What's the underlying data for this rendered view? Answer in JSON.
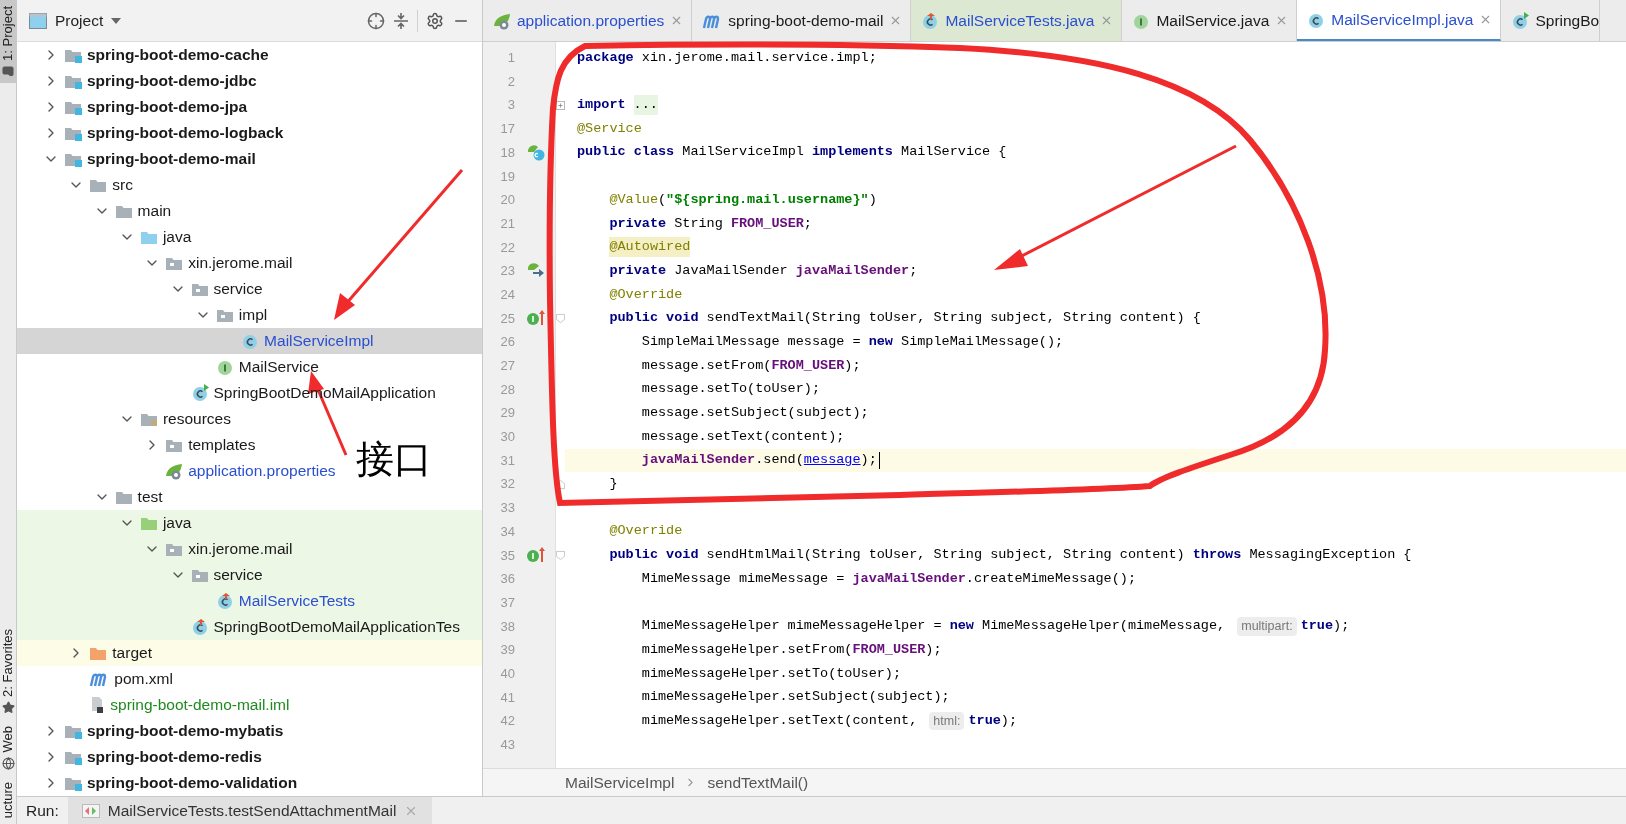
{
  "tool_strip": [
    {
      "label": "1: Project",
      "selected": true
    },
    {
      "label": "2: Favorites",
      "selected": false
    },
    {
      "label": "Web",
      "selected": false
    },
    {
      "label": "ucture",
      "selected": false
    }
  ],
  "project_panel": {
    "title": "Project",
    "tree": [
      {
        "label": "spring-boot-demo-cache",
        "kind": "module",
        "expanded": false,
        "selected": false
      },
      {
        "label": "spring-boot-demo-jdbc",
        "kind": "module",
        "expanded": false,
        "selected": false
      },
      {
        "label": "spring-boot-demo-jpa",
        "kind": "module",
        "expanded": false,
        "selected": false
      },
      {
        "label": "spring-boot-demo-logback",
        "kind": "module",
        "expanded": false,
        "selected": false
      },
      {
        "label": "spring-boot-demo-mail",
        "kind": "module",
        "expanded": true,
        "selected": false,
        "children": [
          {
            "label": "src",
            "kind": "folder",
            "expanded": true,
            "selected": false,
            "children": [
              {
                "label": "main",
                "kind": "folder",
                "expanded": true,
                "selected": false,
                "children": [
                  {
                    "label": "java",
                    "kind": "source-folder",
                    "expanded": true,
                    "selected": false,
                    "children": [
                      {
                        "label": "xin.jerome.mail",
                        "kind": "package",
                        "expanded": true,
                        "selected": false,
                        "children": [
                          {
                            "label": "service",
                            "kind": "package",
                            "expanded": true,
                            "selected": false,
                            "children": [
                              {
                                "label": "impl",
                                "kind": "package",
                                "expanded": true,
                                "selected": false,
                                "children": [
                                  {
                                    "label": "MailServiceImpl",
                                    "kind": "class",
                                    "color": "#2a4fcf",
                                    "selected": true
                                  }
                                ]
                              },
                              {
                                "label": "MailService",
                                "kind": "interface",
                                "selected": false
                              }
                            ]
                          },
                          {
                            "label": "SpringBootDemoMailApplication",
                            "kind": "boot-class",
                            "selected": false
                          }
                        ]
                      }
                    ]
                  },
                  {
                    "label": "resources",
                    "kind": "resources-folder",
                    "expanded": true,
                    "selected": false,
                    "children": [
                      {
                        "label": "templates",
                        "kind": "package",
                        "expanded": false,
                        "selected": false
                      },
                      {
                        "label": "application.properties",
                        "kind": "properties",
                        "color": "#2a4fcf",
                        "selected": false
                      }
                    ]
                  }
                ]
              },
              {
                "label": "test",
                "kind": "folder",
                "expanded": true,
                "selected": false,
                "children": [
                  {
                    "label": "java",
                    "kind": "test-folder",
                    "expanded": true,
                    "selected": false,
                    "children": [
                      {
                        "label": "xin.jerome.mail",
                        "kind": "package",
                        "expanded": true,
                        "selected": false,
                        "children": [
                          {
                            "label": "service",
                            "kind": "package",
                            "expanded": true,
                            "selected": false,
                            "children": [
                              {
                                "label": "MailServiceTests",
                                "kind": "test-class",
                                "color": "#2a4fcf",
                                "selected": false
                              }
                            ]
                          },
                          {
                            "label": "SpringBootDemoMailApplicationTes",
                            "kind": "test-class",
                            "selected": false
                          }
                        ]
                      }
                    ]
                  }
                ]
              }
            ]
          },
          {
            "label": "target",
            "kind": "excluded-folder",
            "expanded": false,
            "selected": false
          },
          {
            "label": "pom.xml",
            "kind": "maven",
            "selected": false
          },
          {
            "label": "spring-boot-demo-mail.iml",
            "kind": "iml",
            "color": "#1f8a1f",
            "selected": false
          }
        ]
      },
      {
        "label": "spring-boot-demo-mybatis",
        "kind": "module",
        "expanded": false,
        "selected": false
      },
      {
        "label": "spring-boot-demo-redis",
        "kind": "module",
        "expanded": false,
        "selected": false
      },
      {
        "label": "spring-boot-demo-validation",
        "kind": "module",
        "expanded": false,
        "selected": false
      }
    ]
  },
  "editor_tabs": [
    {
      "label": "application.properties",
      "kind": "properties",
      "color": "#2a4fcf",
      "selected": false,
      "closable": true
    },
    {
      "label": "spring-boot-demo-mail",
      "kind": "maven",
      "selected": false,
      "closable": true
    },
    {
      "label": "MailServiceTests.java",
      "kind": "test-class",
      "color": "#2a4fcf",
      "selected": false,
      "closable": true
    },
    {
      "label": "MailService.java",
      "kind": "interface",
      "selected": false,
      "closable": true
    },
    {
      "label": "MailServiceImpl.java",
      "kind": "class",
      "color": "#2a4fcf",
      "selected": true,
      "closable": true
    },
    {
      "label": "SpringBo",
      "kind": "boot-class",
      "selected": false,
      "closable": false
    }
  ],
  "code_lines": [
    {
      "number": "1",
      "current": false,
      "tokens": [
        {
          "kind": "kw",
          "text": "package"
        },
        {
          "kind": "plain",
          "text": " xin.jerome.mail.service.impl;"
        }
      ]
    },
    {
      "number": "2",
      "current": false
    },
    {
      "number": "3",
      "current": false,
      "fold": {
        "kind": "collapsed"
      },
      "tokens": [
        {
          "kind": "kw",
          "text": "import"
        },
        {
          "kind": "folded",
          "text": "..."
        }
      ]
    },
    {
      "number": "17",
      "current": false,
      "tokens": [
        {
          "kind": "ann",
          "text": "@Service"
        }
      ]
    },
    {
      "number": "18",
      "current": false,
      "gutter": {
        "kind": "bean"
      },
      "tokens": [
        {
          "kind": "kw",
          "text": "public class"
        },
        {
          "kind": "plain",
          "text": " MailServiceImpl "
        },
        {
          "kind": "kw",
          "text": "implements"
        },
        {
          "kind": "plain",
          "text": " MailService {"
        }
      ]
    },
    {
      "number": "19",
      "current": false
    },
    {
      "number": "20",
      "current": false,
      "indent": {
        "kind": "member"
      },
      "tokens": [
        {
          "kind": "ann",
          "text": "@Value"
        },
        {
          "kind": "plain",
          "text": "("
        },
        {
          "kind": "str",
          "text": "\"${spring.mail.username}\""
        },
        {
          "kind": "plain",
          "text": ")"
        }
      ]
    },
    {
      "number": "21",
      "current": false,
      "indent": {
        "kind": "member"
      },
      "tokens": [
        {
          "kind": "kw",
          "text": "private"
        },
        {
          "kind": "plain",
          "text": " String "
        },
        {
          "kind": "field",
          "text": "FROM_USER"
        },
        {
          "kind": "plain",
          "text": ";"
        }
      ]
    },
    {
      "number": "22",
      "current": false,
      "indent": {
        "kind": "member"
      },
      "tokens": [
        {
          "kind": "ann-warn",
          "text": "@Autowired"
        }
      ]
    },
    {
      "number": "23",
      "current": false,
      "indent": {
        "kind": "member"
      },
      "gutter": {
        "kind": "autowired"
      },
      "tokens": [
        {
          "kind": "kw",
          "text": "private"
        },
        {
          "kind": "plain",
          "text": " JavaMailSender "
        },
        {
          "kind": "field",
          "text": "javaMailSender"
        },
        {
          "kind": "plain",
          "text": ";"
        }
      ]
    },
    {
      "number": "24",
      "current": false,
      "indent": {
        "kind": "member"
      },
      "tokens": [
        {
          "kind": "ann",
          "text": "@Override"
        }
      ]
    },
    {
      "number": "25",
      "current": false,
      "indent": {
        "kind": "member"
      },
      "gutter": {
        "kind": "implements"
      },
      "fold": {
        "kind": "start"
      },
      "tokens": [
        {
          "kind": "kw",
          "text": "public void"
        },
        {
          "kind": "plain",
          "text": " sendTextMail(String toUser, String subject, String content) {"
        }
      ]
    },
    {
      "number": "26",
      "current": false,
      "indent": {
        "kind": "body"
      },
      "tokens": [
        {
          "kind": "plain",
          "text": "SimpleMailMessage message = "
        },
        {
          "kind": "kw",
          "text": "new"
        },
        {
          "kind": "plain",
          "text": " SimpleMailMessage();"
        }
      ]
    },
    {
      "number": "27",
      "current": false,
      "indent": {
        "kind": "body"
      },
      "tokens": [
        {
          "kind": "plain",
          "text": "message.setFrom("
        },
        {
          "kind": "field",
          "text": "FROM_USER"
        },
        {
          "kind": "plain",
          "text": ");"
        }
      ]
    },
    {
      "number": "28",
      "current": false,
      "indent": {
        "kind": "body"
      },
      "tokens": [
        {
          "kind": "plain",
          "text": "message.setTo(toUser);"
        }
      ]
    },
    {
      "number": "29",
      "current": false,
      "indent": {
        "kind": "body"
      },
      "tokens": [
        {
          "kind": "plain",
          "text": "message.setSubject(subject);"
        }
      ]
    },
    {
      "number": "30",
      "current": false,
      "indent": {
        "kind": "body"
      },
      "tokens": [
        {
          "kind": "plain",
          "text": "message.setText(content);"
        }
      ]
    },
    {
      "number": "31",
      "current": true,
      "indent": {
        "kind": "body"
      },
      "tokens": [
        {
          "kind": "field",
          "text": "javaMailSender"
        },
        {
          "kind": "plain",
          "text": ".send("
        },
        {
          "kind": "link",
          "text": "message"
        },
        {
          "kind": "plain",
          "text": ");"
        }
      ]
    },
    {
      "number": "32",
      "current": false,
      "indent": {
        "kind": "member"
      },
      "fold": {
        "kind": "end"
      },
      "tokens": [
        {
          "kind": "plain",
          "text": "}"
        }
      ]
    },
    {
      "number": "33",
      "current": false
    },
    {
      "number": "34",
      "current": false,
      "indent": {
        "kind": "member"
      },
      "tokens": [
        {
          "kind": "ann",
          "text": "@Override"
        }
      ]
    },
    {
      "number": "35",
      "current": false,
      "indent": {
        "kind": "member"
      },
      "gutter": {
        "kind": "implements"
      },
      "fold": {
        "kind": "start"
      },
      "tokens": [
        {
          "kind": "kw",
          "text": "public void"
        },
        {
          "kind": "plain",
          "text": " sendHtmlMail(String toUser, String subject, String content) "
        },
        {
          "kind": "kw",
          "text": "throws"
        },
        {
          "kind": "plain",
          "text": " MessagingException {"
        }
      ]
    },
    {
      "number": "36",
      "current": false,
      "indent": {
        "kind": "body"
      },
      "tokens": [
        {
          "kind": "plain",
          "text": "MimeMessage mimeMessage = "
        },
        {
          "kind": "field",
          "text": "javaMailSender"
        },
        {
          "kind": "plain",
          "text": ".createMimeMessage();"
        }
      ]
    },
    {
      "number": "37",
      "current": false
    },
    {
      "number": "38",
      "current": false,
      "indent": {
        "kind": "body"
      },
      "tokens": [
        {
          "kind": "plain",
          "text": "MimeMessageHelper mimeMessageHelper = "
        },
        {
          "kind": "kw",
          "text": "new"
        },
        {
          "kind": "plain",
          "text": " MimeMessageHelper(mimeMessage, "
        },
        {
          "kind": "hint",
          "text": "multipart:"
        },
        {
          "kind": "kw",
          "text": "true"
        },
        {
          "kind": "plain",
          "text": ");"
        }
      ]
    },
    {
      "number": "39",
      "current": false,
      "indent": {
        "kind": "body"
      },
      "tokens": [
        {
          "kind": "plain",
          "text": "mimeMessageHelper.setFrom("
        },
        {
          "kind": "field",
          "text": "FROM_USER"
        },
        {
          "kind": "plain",
          "text": ");"
        }
      ]
    },
    {
      "number": "40",
      "current": false,
      "indent": {
        "kind": "body"
      },
      "tokens": [
        {
          "kind": "plain",
          "text": "mimeMessageHelper.setTo(toUser);"
        }
      ]
    },
    {
      "number": "41",
      "current": false,
      "indent": {
        "kind": "body"
      },
      "tokens": [
        {
          "kind": "plain",
          "text": "mimeMessageHelper.setSubject(subject);"
        }
      ]
    },
    {
      "number": "42",
      "current": false,
      "indent": {
        "kind": "body"
      },
      "tokens": [
        {
          "kind": "plain",
          "text": "mimeMessageHelper.setText(content, "
        },
        {
          "kind": "hint",
          "text": "html:"
        },
        {
          "kind": "kw",
          "text": "true"
        },
        {
          "kind": "plain",
          "text": ");"
        }
      ]
    },
    {
      "number": "43",
      "current": false
    }
  ],
  "breadcrumbs": [
    "MailServiceImpl",
    "sendTextMail()"
  ],
  "run_bar": {
    "label": "Run:",
    "tab": "MailServiceTests.testSendAttachmentMail"
  },
  "annotation": {
    "label": "接口"
  }
}
